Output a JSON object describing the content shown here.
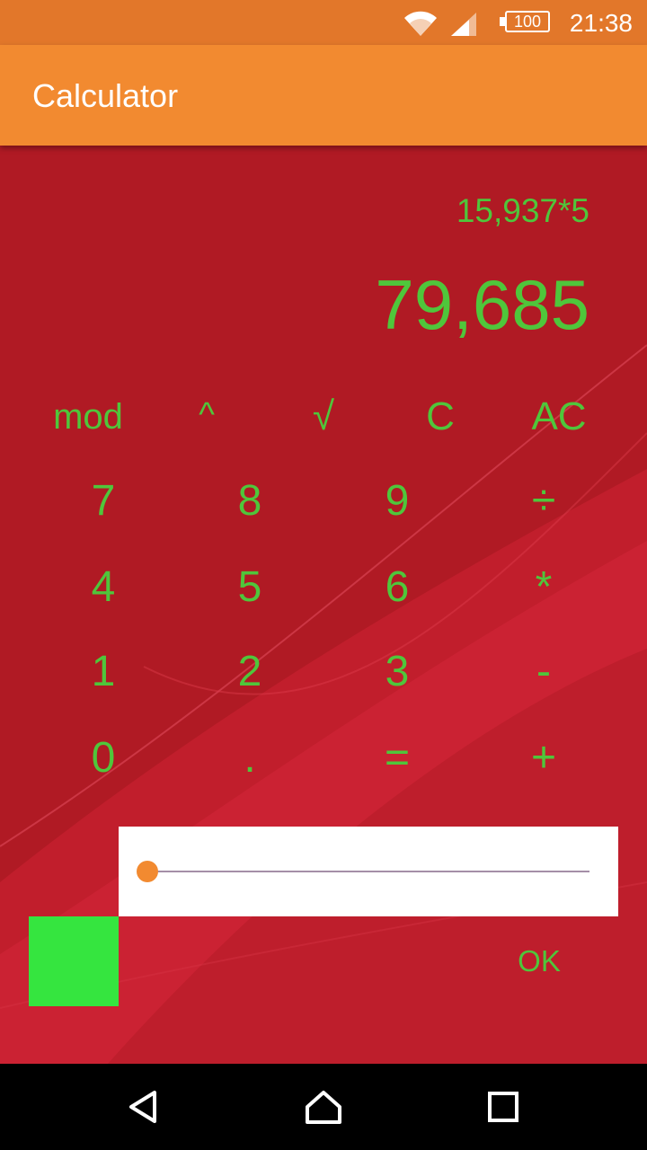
{
  "status_bar": {
    "time": "21:38",
    "battery": "100"
  },
  "app_bar": {
    "title": "Calculator"
  },
  "display": {
    "expression": "15,937*5",
    "result": "79,685"
  },
  "keypad": {
    "functions": [
      "mod",
      "^",
      "√",
      "C",
      "AC"
    ],
    "row1": [
      "7",
      "8",
      "9",
      "÷"
    ],
    "row2": [
      "4",
      "5",
      "6",
      "*"
    ],
    "row3": [
      "1",
      "2",
      "3",
      "-"
    ],
    "row4": [
      "0",
      ".",
      "=",
      "+"
    ]
  },
  "color_picker": {
    "slider_value": 0,
    "swatch_color": "#35e53f",
    "ok_label": "OK"
  },
  "colors": {
    "accent": "#f28a30",
    "background": "#b01a24",
    "text": "#4fc63b"
  }
}
